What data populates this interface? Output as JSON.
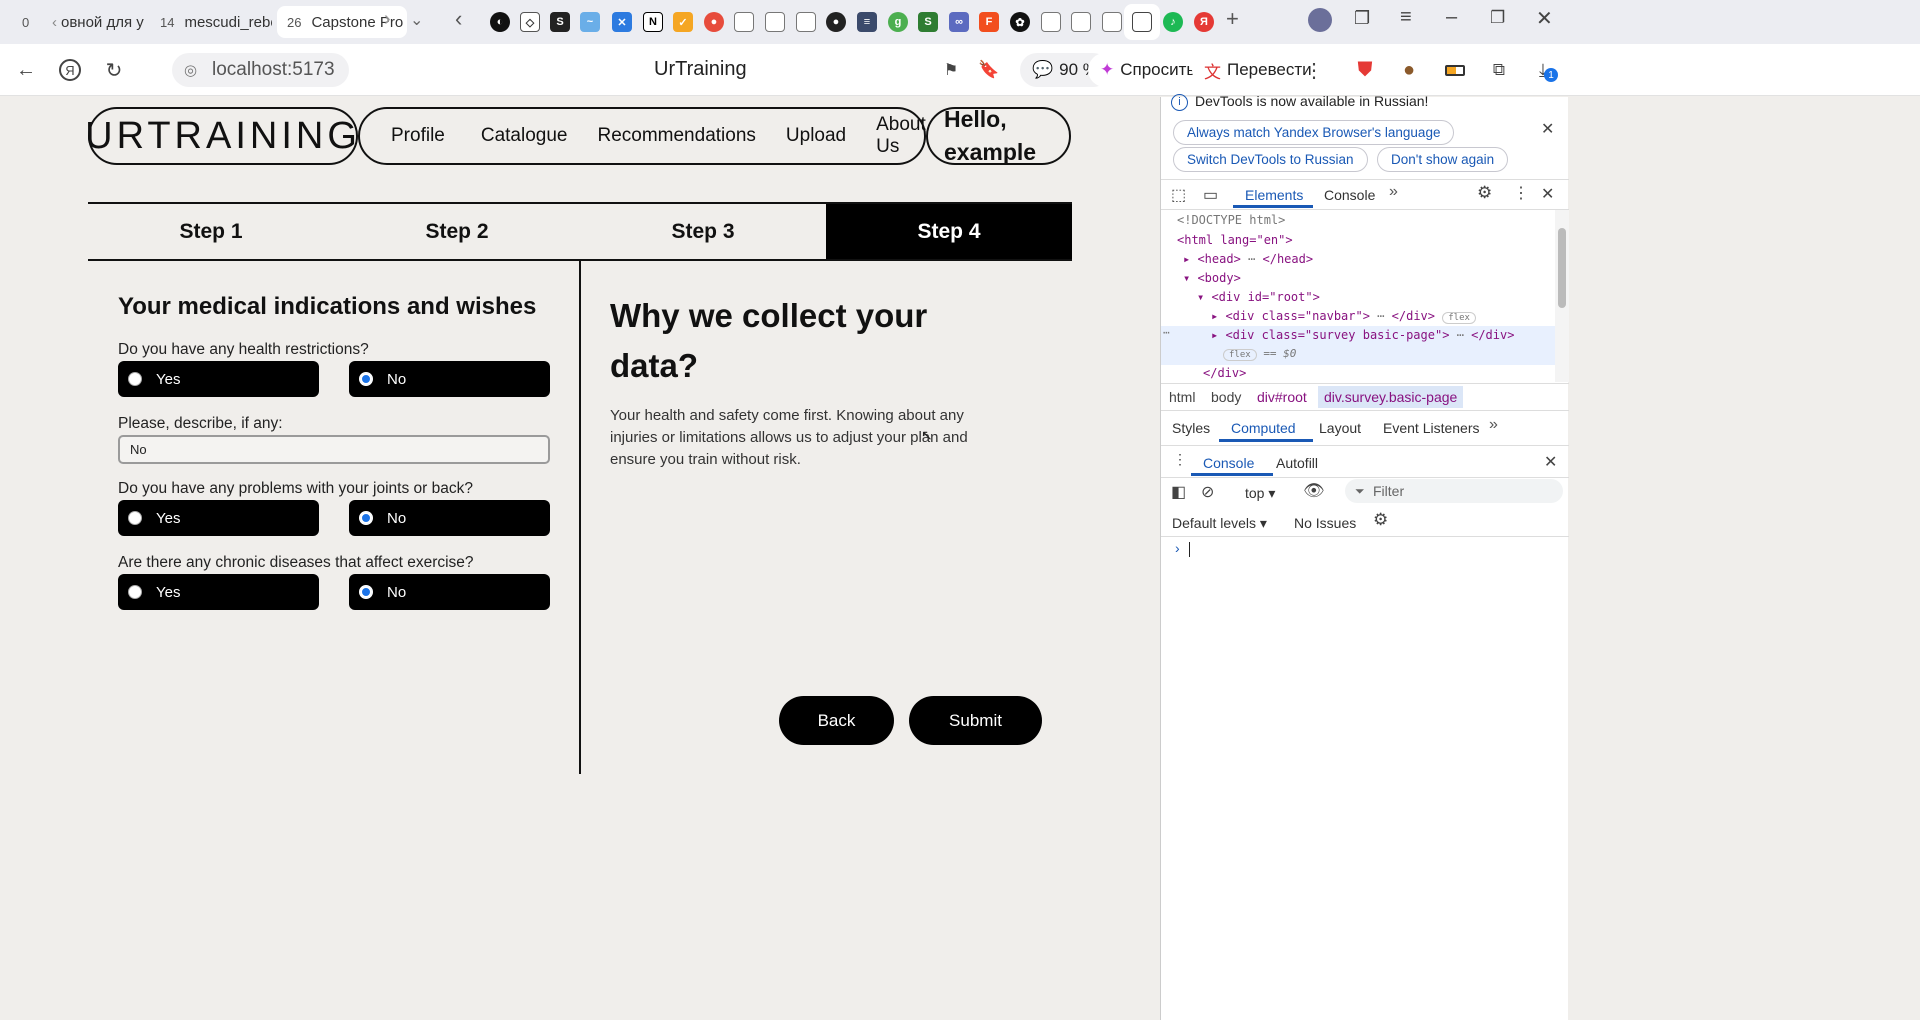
{
  "browser": {
    "tabs": [
      {
        "num": "0",
        "label": ""
      },
      {
        "num": "",
        "label": "овной для у"
      },
      {
        "num": "14",
        "label": "mescudi_reborn"
      },
      {
        "num": "26",
        "label": "Capstone Pro"
      }
    ],
    "url": "localhost:5173",
    "page_title": "UrTraining",
    "zoom": "90 %",
    "ask_label": "Спросить",
    "translate_label": "Перевести",
    "downloads_badge": "1"
  },
  "nav": {
    "logo": "URTRAINING",
    "links": [
      "Profile",
      "Catalogue",
      "Recommendations",
      "Upload",
      "About Us"
    ],
    "greeting_line1": "Hello,",
    "greeting_line2": "example"
  },
  "steps": [
    "Step 1",
    "Step 2",
    "Step 3",
    "Step 4"
  ],
  "active_step": 4,
  "form": {
    "title": "Your medical indications and wishes",
    "q1": "Do you have any health restrictions?",
    "q1_answer": "No",
    "describe_label": "Please, describe, if any:",
    "describe_value": "No",
    "q2": "Do you have any problems with your joints or back?",
    "q2_answer": "No",
    "q3": "Are there any chronic diseases that affect exercise?",
    "q3_answer": "No",
    "yes_label": "Yes",
    "no_label": "No"
  },
  "info": {
    "title_line1": "Why we collect your",
    "title_line2": "data?",
    "text_line1": "Your health and safety come first. Knowing about any",
    "text_line2": "injuries or limitations allows us to adjust your plan and",
    "text_line3": "ensure you train without risk."
  },
  "actions": {
    "back": "Back",
    "submit": "Submit"
  },
  "devtools": {
    "notice": "DevTools is now available in Russian!",
    "btn_match": "Always match Yandex Browser's language",
    "btn_switch": "Switch DevTools to Russian",
    "btn_dont": "Don't show again",
    "tab_elements": "Elements",
    "tab_console": "Console",
    "dom": {
      "doctype": "<!DOCTYPE html>",
      "html_open": "<html lang=\"en\">",
      "head": "<head>",
      "head_close": "</head>",
      "body": "<body>",
      "root": "<div id=\"root\">",
      "navbar": "<div class=\"navbar\">",
      "survey": "<div class=\"survey basic-page\">",
      "div_close": "</div>",
      "flex_badge": "flex",
      "eq": "== $0"
    },
    "crumbs": [
      "html",
      "body",
      "div#root",
      "div.survey.basic-page"
    ],
    "subtabs": [
      "Styles",
      "Computed",
      "Layout",
      "Event Listeners"
    ],
    "drawer_tabs": [
      "Console",
      "Autofill"
    ],
    "context": "top",
    "filter_placeholder": "Filter",
    "levels": "Default levels",
    "issues": "No Issues"
  }
}
